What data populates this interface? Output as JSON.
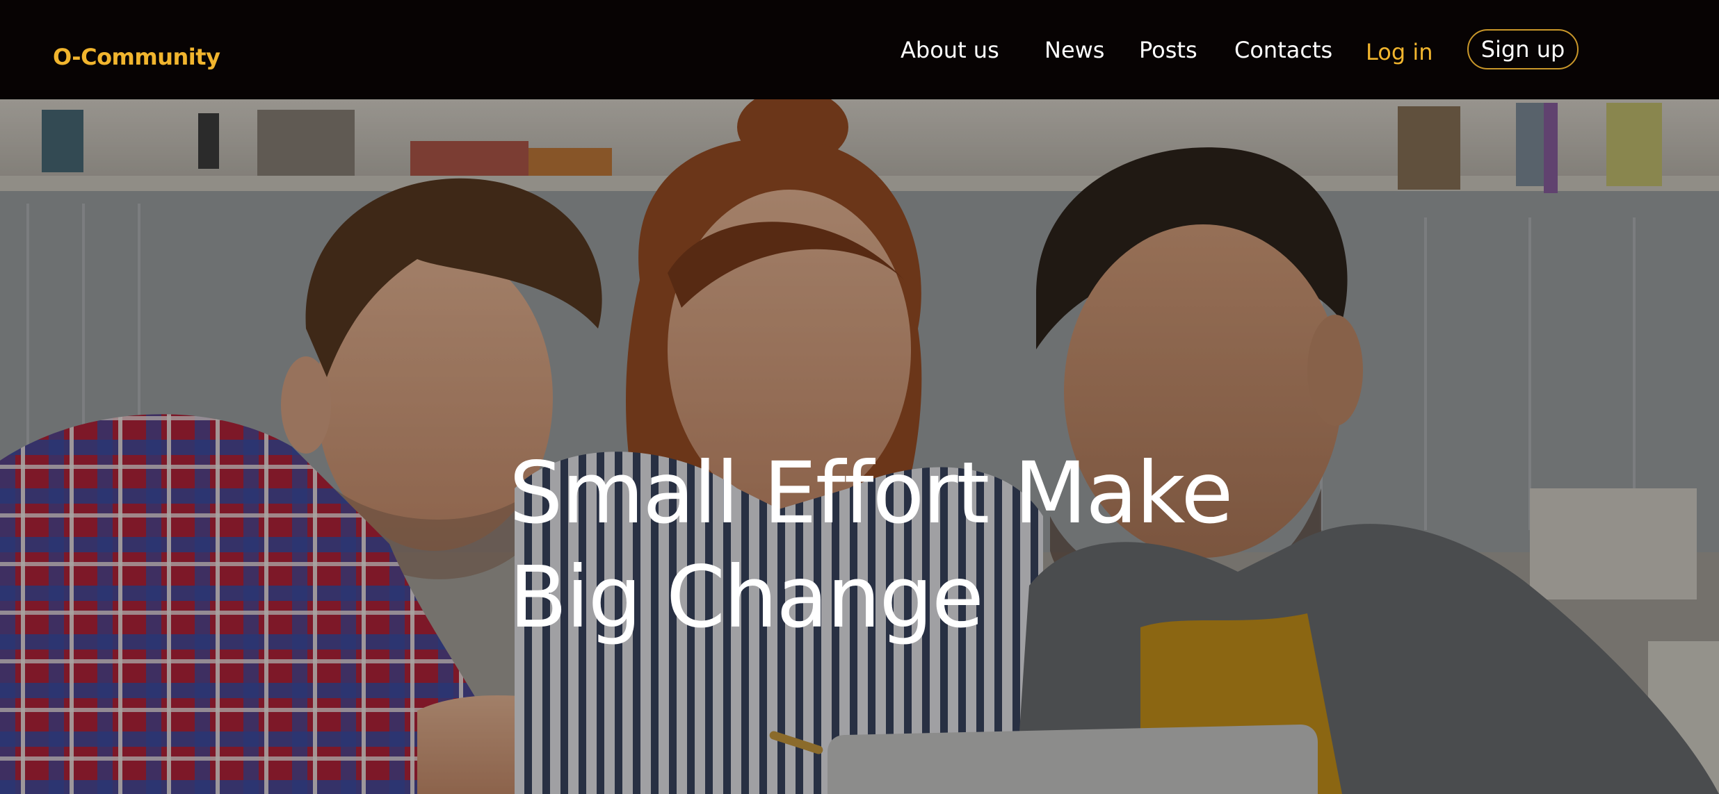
{
  "brand": {
    "name": "O-Community",
    "color": "#f1b52e"
  },
  "nav": {
    "about": "About us",
    "news": "News",
    "posts": "Posts",
    "contacts": "Contacts",
    "login": "Log in",
    "signup": "Sign up"
  },
  "hero": {
    "title_line1": "Small Effort Make",
    "title_line2": "Big Change",
    "image_description_icon": "photo-of-three-people-looking-at-laptop"
  },
  "colors": {
    "navbar_bg": "#070303",
    "accent": "#f1b52e",
    "text": "#ffffff"
  }
}
